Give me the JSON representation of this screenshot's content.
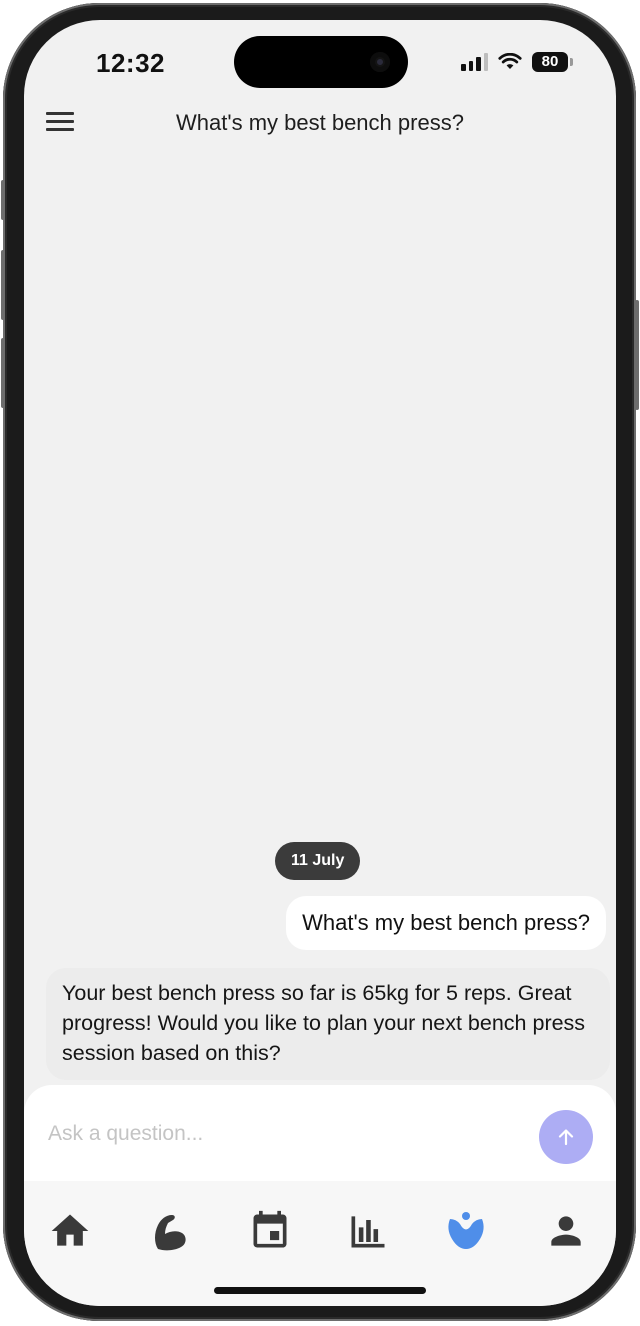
{
  "status_bar": {
    "time": "12:32",
    "battery": "80"
  },
  "header": {
    "title": "What's my best bench press?"
  },
  "chat": {
    "date_label": "11 July",
    "messages": [
      {
        "role": "user",
        "text": "What's my best bench press?"
      },
      {
        "role": "assistant",
        "text": "Your best bench press so far is 65kg for 5 reps. Great progress! Would you like to plan your next bench press session based on this?"
      }
    ]
  },
  "input": {
    "placeholder": "Ask a question...",
    "value": ""
  },
  "tabs": [
    {
      "icon": "home-icon",
      "active": false
    },
    {
      "icon": "flexed-arm-icon",
      "active": false
    },
    {
      "icon": "calendar-icon",
      "active": false
    },
    {
      "icon": "bar-chart-icon",
      "active": false
    },
    {
      "icon": "assistant-icon",
      "active": true
    },
    {
      "icon": "person-icon",
      "active": false
    }
  ],
  "colors": {
    "active_tab": "#4f8ee9",
    "inactive_tab": "#3a3a3a",
    "send_button": "#adadf4",
    "date_pill": "#3b3b3b"
  }
}
